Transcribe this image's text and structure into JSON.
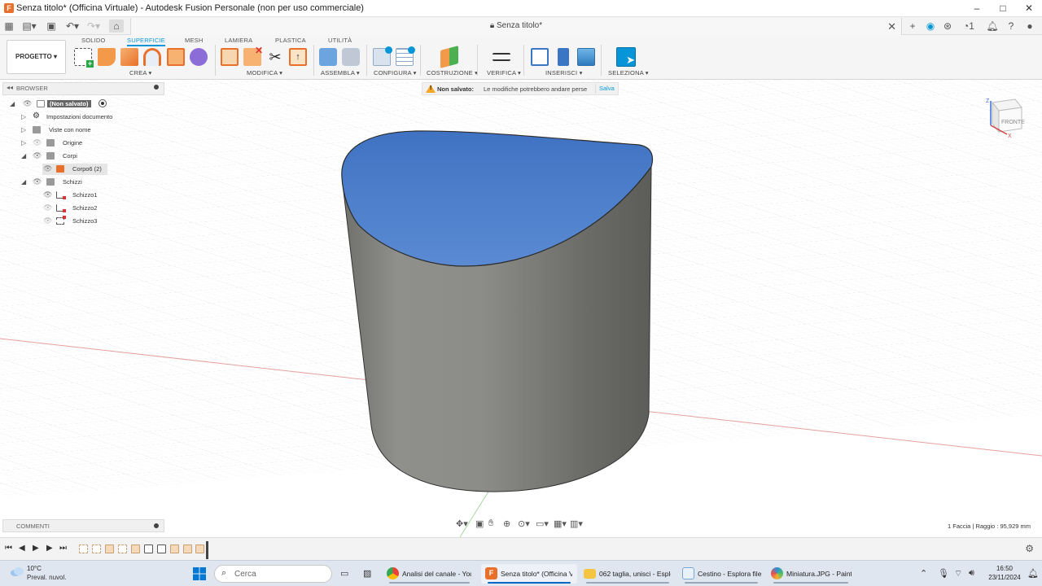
{
  "window": {
    "title": "Senza titolo* (Officina Virtuale) - Autodesk Fusion Personale (non per uso commerciale)",
    "minimize": "–",
    "maximize": "□",
    "close": "✕"
  },
  "document_tab": {
    "label": "Senza titolo*",
    "close": "✕"
  },
  "badge_count": "1",
  "ribbon": {
    "workspace": "PROGETTO ▾",
    "tabs": [
      {
        "label": "SOLIDO"
      },
      {
        "label": "SUPERFICIE"
      },
      {
        "label": "MESH"
      },
      {
        "label": "LAMIERA"
      },
      {
        "label": "PLASTICA"
      },
      {
        "label": "UTILITÀ"
      }
    ],
    "active_tab": "SUPERFICIE",
    "groups": [
      {
        "label": "CREA ▾"
      },
      {
        "label": "MODIFICA ▾"
      },
      {
        "label": "ASSEMBLA ▾"
      },
      {
        "label": "CONFIGURA ▾"
      },
      {
        "label": "COSTRUZIONE ▾"
      },
      {
        "label": "VERIFICA ▾"
      },
      {
        "label": "INSERISCI ▾"
      },
      {
        "label": "SELEZIONA ▾"
      }
    ]
  },
  "browser": {
    "title": "BROWSER",
    "items": [
      {
        "label": "(Non salvato)",
        "icon": "document-icon"
      },
      {
        "label": "Impostazioni documento",
        "icon": "gear-icon"
      },
      {
        "label": "Viste con nome",
        "icon": "folder-icon"
      },
      {
        "label": "Origine",
        "icon": "folder-icon"
      },
      {
        "label": "Corpi",
        "icon": "folder-icon"
      },
      {
        "label": "Corpo6 (2)",
        "icon": "body-icon"
      },
      {
        "label": "Schizzi",
        "icon": "folder-icon"
      },
      {
        "label": "Schizzo1",
        "icon": "sketch-icon"
      },
      {
        "label": "Schizzo2",
        "icon": "sketch-icon"
      },
      {
        "label": "Schizzo3",
        "icon": "sketch-icon"
      }
    ]
  },
  "warning": {
    "title": "Non salvato:",
    "message": "Le modifiche potrebbero andare perse",
    "action": "Salva"
  },
  "viewcube": {
    "face": "FRONTE",
    "axis_z": "Z",
    "axis_x": "X"
  },
  "comments": {
    "title": "COMMENTI"
  },
  "status": {
    "text": "1 Faccia | Raggio : 95,929 mm"
  },
  "colors": {
    "accent": "#0696d7",
    "selected_face": "#4a7ec9",
    "body": "#8a8a86",
    "warning": "#f5a623",
    "body_feature": "#e8702a"
  },
  "taskbar": {
    "weather": {
      "temp": "10°C",
      "condition": "Preval. nuvol."
    },
    "search_placeholder": "Cerca",
    "apps": [
      {
        "label": "Analisi del canale - YouT",
        "icon": "chrome-icon"
      },
      {
        "label": "Senza titolo* (Officina V",
        "icon": "fusion-icon"
      },
      {
        "label": "062 taglia, unisci - Esplo",
        "icon": "folder-icon"
      },
      {
        "label": "Cestino - Esplora file",
        "icon": "recycle-bin-icon"
      },
      {
        "label": "Miniatura.JPG - Paint",
        "icon": "paint-icon"
      }
    ],
    "time": "16:50",
    "date": "23/11/2024"
  }
}
